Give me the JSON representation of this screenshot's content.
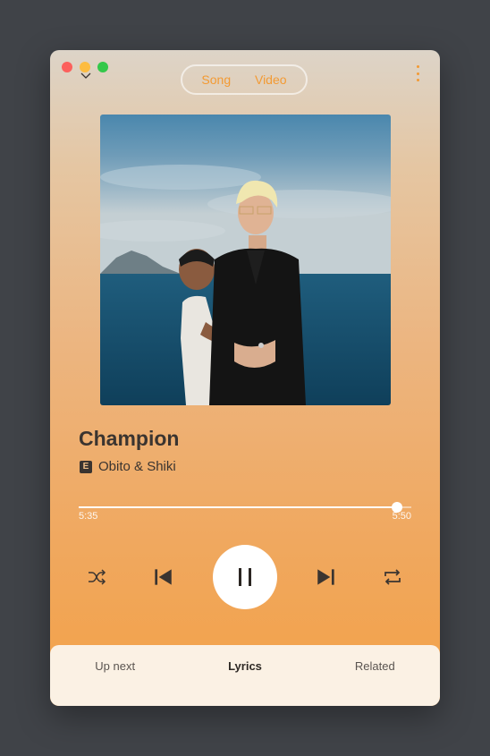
{
  "window": {
    "colors": {
      "accent": "#f39a33",
      "background_top": "#ddd4c8",
      "background_bottom": "#f3a147",
      "bottom_panel": "#fbf1e4"
    }
  },
  "header": {
    "tabs": [
      {
        "label": "Song",
        "active": true
      },
      {
        "label": "Video",
        "active": false
      }
    ],
    "menu_icon": "more-vertical-icon",
    "collapse_icon": "chevron-down-icon"
  },
  "track": {
    "title": "Champion",
    "explicit_badge": "E",
    "artist": "Obito & Shiki",
    "current_time": "5:35",
    "duration": "5:50",
    "progress_fraction": 0.957
  },
  "controls": {
    "shuffle_icon": "shuffle-icon",
    "previous_icon": "skip-previous-icon",
    "play_pause_icon": "pause-icon",
    "next_icon": "skip-next-icon",
    "repeat_icon": "repeat-icon"
  },
  "bottom_tabs": [
    {
      "label": "Up next",
      "active": false
    },
    {
      "label": "Lyrics",
      "active": true
    },
    {
      "label": "Related",
      "active": false
    }
  ]
}
